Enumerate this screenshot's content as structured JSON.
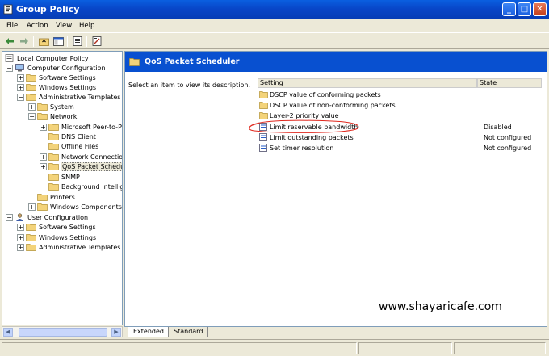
{
  "window": {
    "title": "Group Policy",
    "minimize": "_",
    "maximize": "□",
    "close": "✕"
  },
  "menu": [
    "File",
    "Action",
    "View",
    "Help"
  ],
  "tree": {
    "root": "Local Computer Policy",
    "computer_config": "Computer Configuration",
    "software_settings": "Software Settings",
    "windows_settings": "Windows Settings",
    "admin_templates": "Administrative Templates",
    "system": "System",
    "network": "Network",
    "ms_peer": "Microsoft Peer-to-P",
    "dns_client": "DNS Client",
    "offline_files": "Offline Files",
    "network_connections": "Network Connectio",
    "qos": "QoS Packet Schedu",
    "snmp": "SNMP",
    "bits": "Background Intellige",
    "printers": "Printers",
    "windows_components": "Windows Components",
    "user_config": "User Configuration",
    "u_software_settings": "Software Settings",
    "u_windows_settings": "Windows Settings",
    "u_admin_templates": "Administrative Templates"
  },
  "right": {
    "header_title": "QoS Packet Scheduler",
    "description": "Select an item to view its description.",
    "col_setting": "Setting",
    "col_state": "State",
    "rows": [
      {
        "name": "DSCP value of conforming packets",
        "state": "",
        "type": "folder"
      },
      {
        "name": "DSCP value of non-conforming packets",
        "state": "",
        "type": "folder"
      },
      {
        "name": "Layer-2 priority value",
        "state": "",
        "type": "folder"
      },
      {
        "name": "Limit reservable bandwidth",
        "state": "Disabled",
        "type": "setting"
      },
      {
        "name": "Limit outstanding packets",
        "state": "Not configured",
        "type": "setting"
      },
      {
        "name": "Set timer resolution",
        "state": "Not configured",
        "type": "setting"
      }
    ],
    "watermark": "www.shayaricafe.com"
  },
  "tabs": {
    "extended": "Extended",
    "standard": "Standard"
  },
  "colors": {
    "header_blue": "#0850d0",
    "folder": "#f3d37a",
    "annotation_red": "#e0281e"
  }
}
